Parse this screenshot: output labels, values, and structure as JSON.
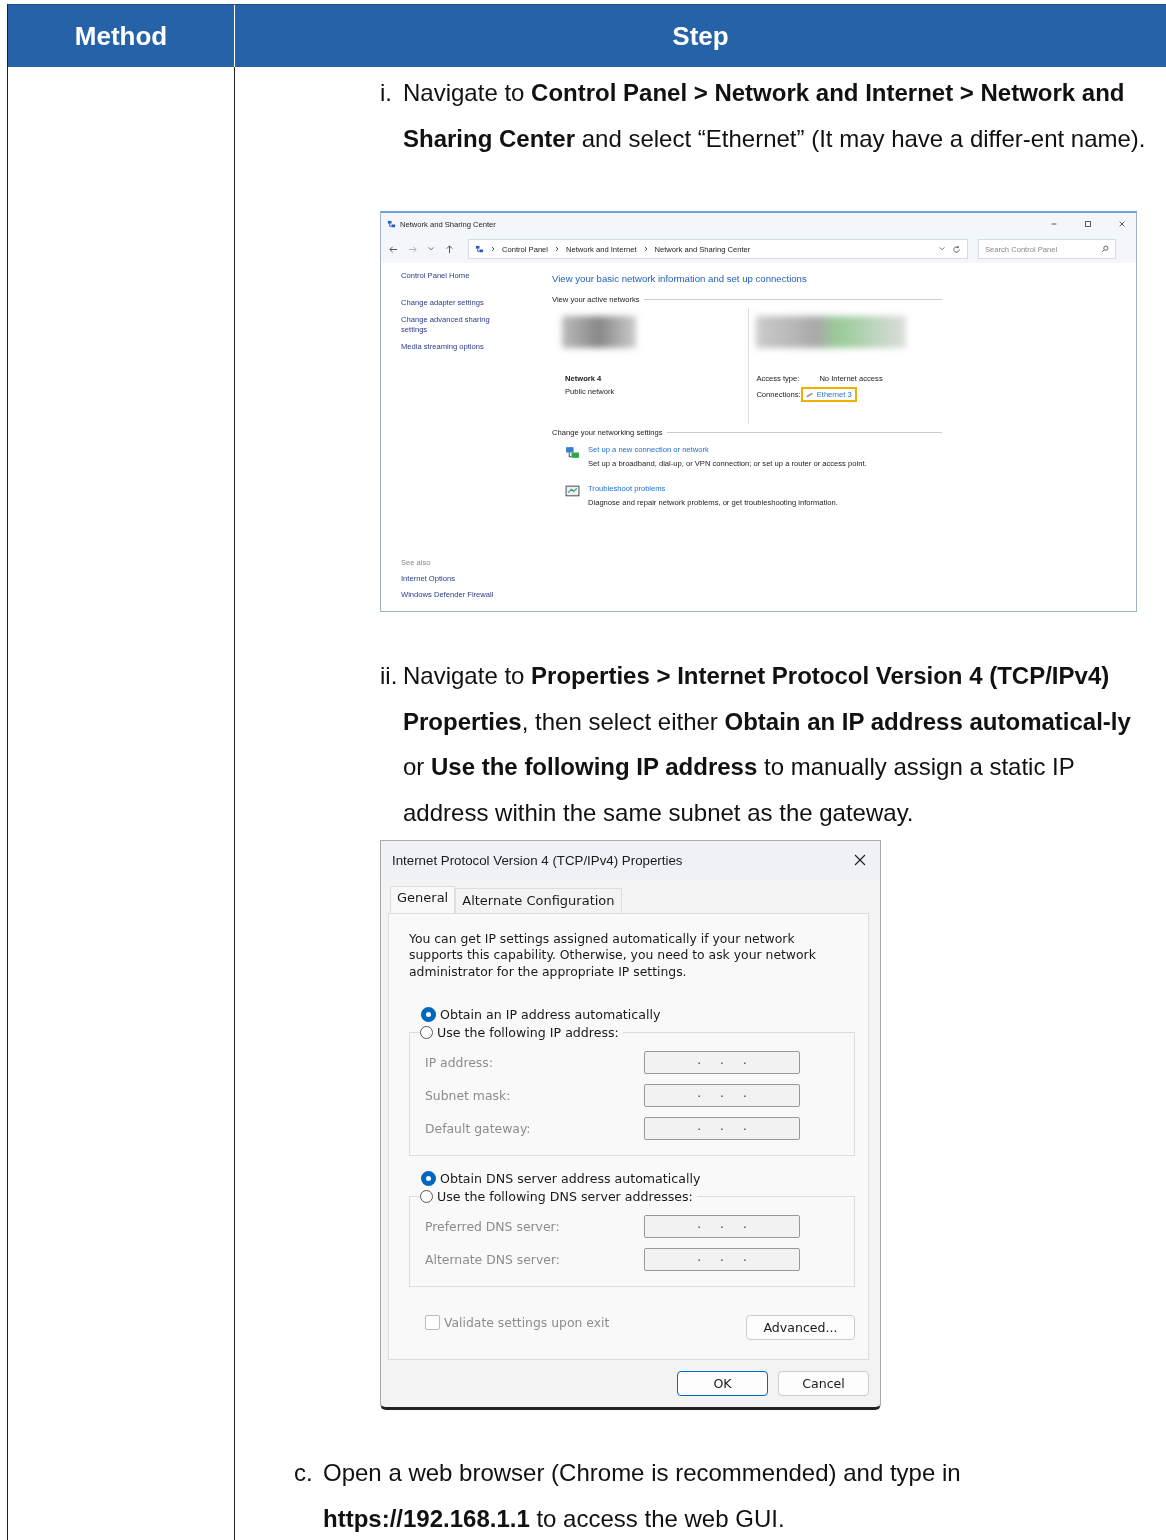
{
  "table": {
    "columns": [
      "Method",
      "Step"
    ]
  },
  "substeps": [
    {
      "marker": "i.",
      "text": "Navigate to **Control Panel > Network and Internet > Network and Sharing Center** and select “Ethernet” (It may have a differ-ent name).",
      "kind": "network_window"
    },
    {
      "marker": "ii.",
      "text": "Navigate to **Properties > Internet Protocol Version 4 (TCP/IPv4) Properties**, then select either **Obtain an IP address automatical-ly** or **Use the following IP address** to manually assign a static IP address within the same subnet as the gateway.",
      "kind": "ipv4_dialog"
    }
  ],
  "next_step": {
    "marker": "c.",
    "text": "Open a web browser (Chrome is recommended) and type in **https://192.168.1.1** to access the web GUI."
  },
  "network_center": {
    "title": "Network and Sharing Center",
    "path": [
      "Control Panel",
      "Network and Internet",
      "Network and Sharing Center"
    ],
    "search_placeholder": "Search Control Panel",
    "sidebar_links": [
      "Control Panel Home",
      "Change adapter settings",
      "Change advanced sharing settings",
      "Media streaming options"
    ],
    "see_also_title": "See also",
    "see_also_links": [
      "Internet Options",
      "Windows Defender Firewall"
    ],
    "heading": "View your basic network information and set up connections",
    "active_networks_label": "View your active networks",
    "network": {
      "name": "Network 4",
      "type": "Public network"
    },
    "access_type_label": "Access type:",
    "access_type": "No Internet access",
    "connections_label": "Connections:",
    "connection": {
      "name": "Ethernet 3",
      "highlighted": true
    },
    "settings_label": "Change your networking settings",
    "tasks": [
      {
        "kind": "setup",
        "link": "Set up a new connection or network",
        "desc": "Set up a broadband, dial-up, or VPN connection; or set up a router or access point."
      },
      {
        "kind": "troubleshoot",
        "link": "Troubleshoot problems",
        "desc": "Diagnose and repair network problems, or get troubleshooting information."
      }
    ]
  },
  "ipv4_dialog": {
    "title": "Internet Protocol Version 4 (TCP/IPv4) Properties",
    "tabs": [
      {
        "label": "General",
        "selected": true
      },
      {
        "label": "Alternate Configuration",
        "selected": false
      }
    ],
    "intro": "You can get IP settings assigned automatically if your network supports this capability. Otherwise, you need to ask your network administrator for the appropriate IP settings.",
    "ip_auto": {
      "label": "Obtain an IP address automatically",
      "selected": true
    },
    "ip_group": {
      "label": "Use the following IP address:",
      "selected": false,
      "disabled": true,
      "fields": [
        {
          "label": "IP address:",
          "value": ".     .     ."
        },
        {
          "label": "Subnet mask:",
          "value": ".     .     ."
        },
        {
          "label": "Default gateway:",
          "value": ".     .     ."
        }
      ]
    },
    "dns_auto": {
      "label": "Obtain DNS server address automatically",
      "selected": true
    },
    "dns_group": {
      "label": "Use the following DNS server addresses:",
      "selected": false,
      "disabled": true,
      "fields": [
        {
          "label": "Preferred DNS server:",
          "value": ".     .     ."
        },
        {
          "label": "Alternate DNS server:",
          "value": ".     .     ."
        }
      ]
    },
    "validate": {
      "label": "Validate settings upon exit",
      "checked": false,
      "disabled": true
    },
    "advanced_button": "Advanced...",
    "buttons": [
      {
        "label": "OK",
        "default": true
      },
      {
        "label": "Cancel",
        "default": false
      }
    ]
  }
}
